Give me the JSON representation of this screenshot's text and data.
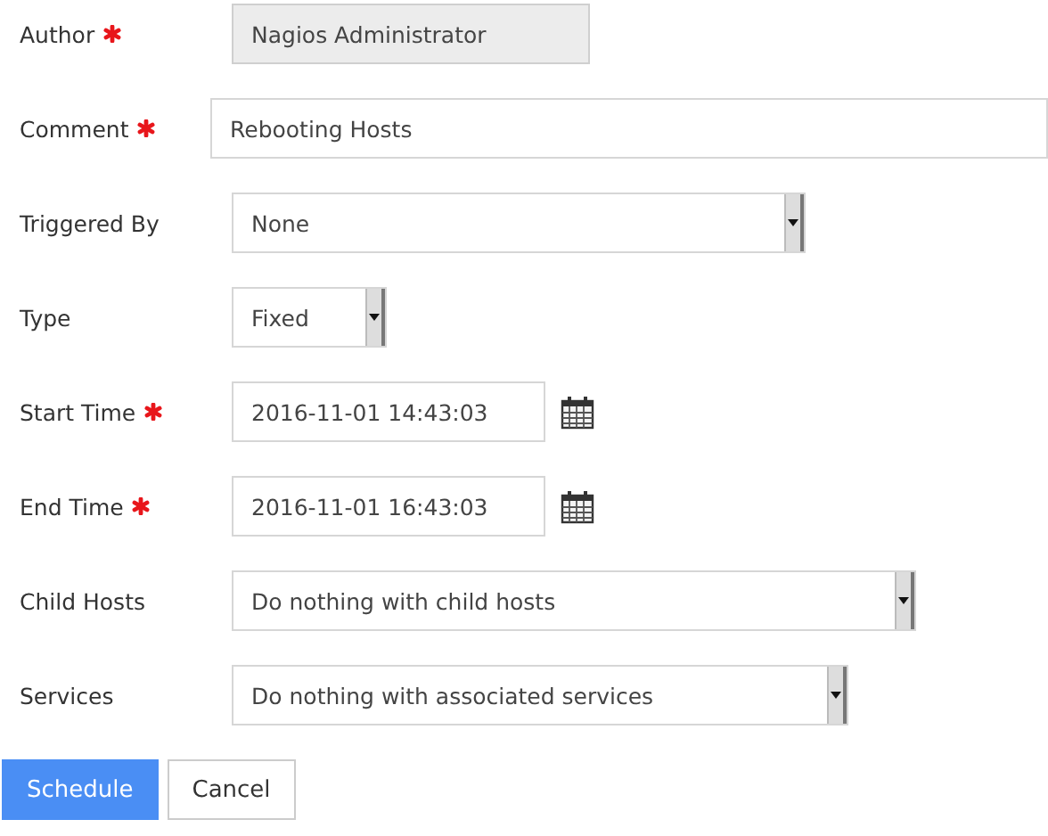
{
  "fields": [
    {
      "label": "Author",
      "required": true,
      "kind": "readonly",
      "value": "Nagios Administrator"
    },
    {
      "label": "Comment",
      "required": true,
      "kind": "text",
      "value": "Rebooting Hosts"
    },
    {
      "label": "Triggered By",
      "required": false,
      "kind": "select",
      "value": "None"
    },
    {
      "label": "Type",
      "required": false,
      "kind": "select",
      "value": "Fixed"
    },
    {
      "label": "Start Time",
      "required": true,
      "kind": "date",
      "value": "2016-11-01 14:43:03"
    },
    {
      "label": "End Time",
      "required": true,
      "kind": "date",
      "value": "2016-11-01 16:43:03"
    },
    {
      "label": "Child Hosts",
      "required": false,
      "kind": "select",
      "value": "Do nothing with child hosts"
    },
    {
      "label": "Services",
      "required": false,
      "kind": "select",
      "value": "Do nothing with associated services"
    }
  ],
  "buttons": [
    {
      "label": "Schedule",
      "kind": "primary"
    },
    {
      "label": "Cancel",
      "kind": "default"
    }
  ]
}
